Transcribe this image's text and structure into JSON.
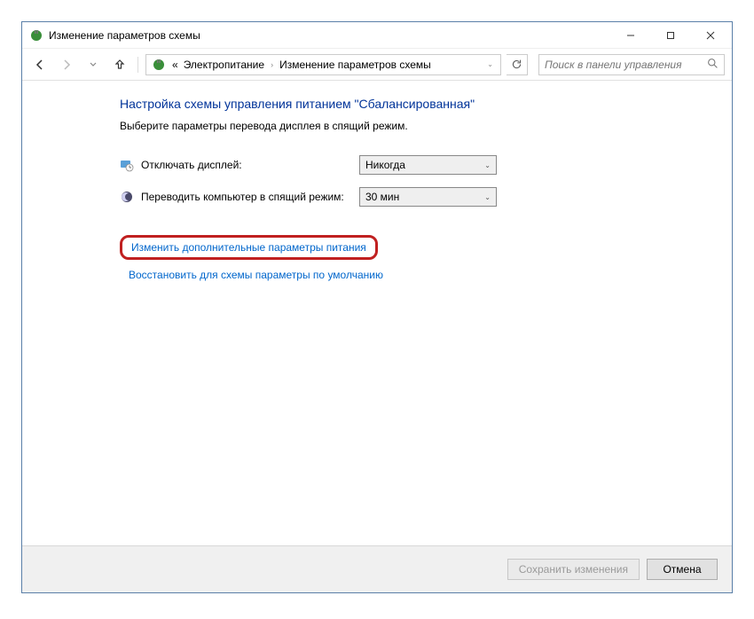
{
  "window": {
    "title": "Изменение параметров схемы"
  },
  "nav": {
    "breadcrumb_prefix": "«",
    "breadcrumb": [
      "Электропитание",
      "Изменение параметров схемы"
    ],
    "search_placeholder": "Поиск в панели управления"
  },
  "page": {
    "heading": "Настройка схемы управления питанием \"Сбалансированная\"",
    "subtext": "Выберите параметры перевода дисплея в спящий режим."
  },
  "settings": [
    {
      "label": "Отключать дисплей:",
      "value": "Никогда"
    },
    {
      "label": "Переводить компьютер в спящий режим:",
      "value": "30 мин"
    }
  ],
  "links": {
    "advanced": "Изменить дополнительные параметры питания",
    "restore": "Восстановить для схемы параметры по умолчанию"
  },
  "footer": {
    "save": "Сохранить изменения",
    "cancel": "Отмена"
  }
}
